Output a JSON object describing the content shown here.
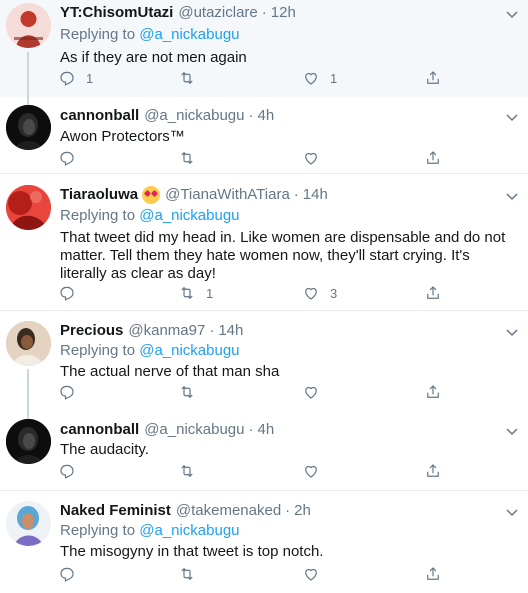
{
  "tweets": [
    {
      "name": "YT:ChisomUtazi",
      "handle": "@utaziclare",
      "time": "12h",
      "has_emoji": false,
      "replying_prefix": "Replying to",
      "replying_to": "@a_nickabugu",
      "text": "As if they are not men again",
      "replies": "1",
      "retweets": "",
      "likes": "1",
      "avatar_caption": ""
    },
    {
      "name": "cannonball",
      "handle": "@a_nickabugu",
      "time": "4h",
      "has_emoji": false,
      "replying_prefix": "",
      "replying_to": "",
      "text": "Awon Protectors™",
      "replies": "",
      "retweets": "",
      "likes": ""
    },
    {
      "name": "Tiaraoluwa",
      "handle": "@TianaWithATiara",
      "time": "14h",
      "has_emoji": true,
      "replying_prefix": "Replying to",
      "replying_to": "@a_nickabugu",
      "text": "That tweet did my head in. Like women are dispensable and do not matter. Tell them they hate women now, they'll start crying. It's literally as clear as day!",
      "replies": "",
      "retweets": "1",
      "likes": "3"
    },
    {
      "name": "Precious",
      "handle": "@kanma97",
      "time": "14h",
      "has_emoji": false,
      "replying_prefix": "Replying to",
      "replying_to": "@a_nickabugu",
      "text": "The actual nerve of that man sha",
      "replies": "",
      "retweets": "",
      "likes": ""
    },
    {
      "name": "cannonball",
      "handle": "@a_nickabugu",
      "time": "4h",
      "has_emoji": false,
      "replying_prefix": "",
      "replying_to": "",
      "text": "The audacity.",
      "replies": "",
      "retweets": "",
      "likes": ""
    },
    {
      "name": "Naked Feminist",
      "handle": "@takemenaked",
      "time": "2h",
      "has_emoji": false,
      "replying_prefix": "Replying to",
      "replying_to": "@a_nickabugu",
      "text": "The misogyny in that tweet is top notch.",
      "replies": "",
      "retweets": "",
      "likes": ""
    }
  ],
  "colors": {
    "text": "#14171a",
    "secondary": "#657786",
    "link": "#1da1f2",
    "border": "#e6ecf0",
    "thread": "#ccd6dd",
    "shaded_bg": "#f5f8fa"
  },
  "icons": {
    "reply": "reply-icon",
    "retweet": "retweet-icon",
    "like": "heart-icon",
    "share": "share-icon",
    "more": "chevron-down-icon"
  }
}
